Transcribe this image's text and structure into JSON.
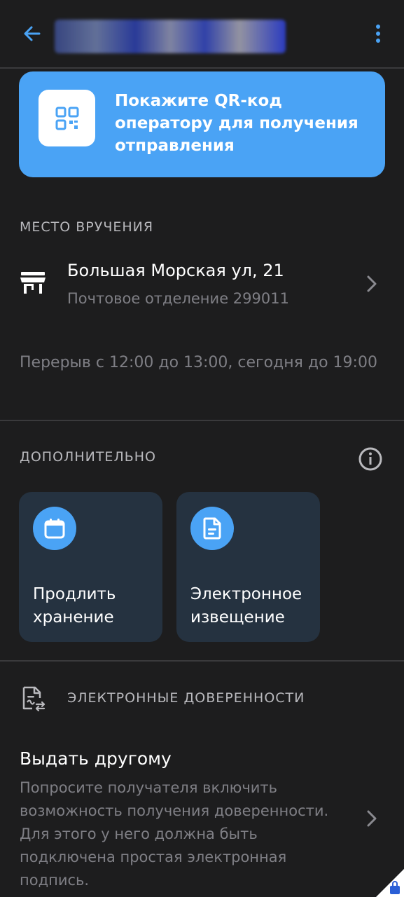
{
  "qr_banner": {
    "text": "Покажите QR-код оператору для получения отправления"
  },
  "delivery": {
    "section_label": "МЕСТО ВРУЧЕНИЯ",
    "address": "Большая Морская ул, 21",
    "office": "Почтовое отделение 299011",
    "hours": "Перерыв с 12:00 до 13:00, сегодня до 19:00"
  },
  "extra": {
    "section_label": "ДОПОЛНИТЕЛЬНО",
    "tiles": [
      {
        "label": "Продлить хранение",
        "icon": "calendar-icon"
      },
      {
        "label": "Электронное извещение",
        "icon": "document-icon"
      }
    ]
  },
  "e_power": {
    "section_label": "ЭЛЕКТРОННЫЕ ДОВЕРЕННОСТИ",
    "give_title": "Выдать другому",
    "give_desc": "Попросите получателя включить возможность получения доверенности. Для этого у него должна быть подключена простая электронная подпись."
  },
  "colors": {
    "background": "#1d1d1e",
    "accent": "#4aa3f5",
    "tile": "#253240",
    "muted": "#7f7f85"
  }
}
